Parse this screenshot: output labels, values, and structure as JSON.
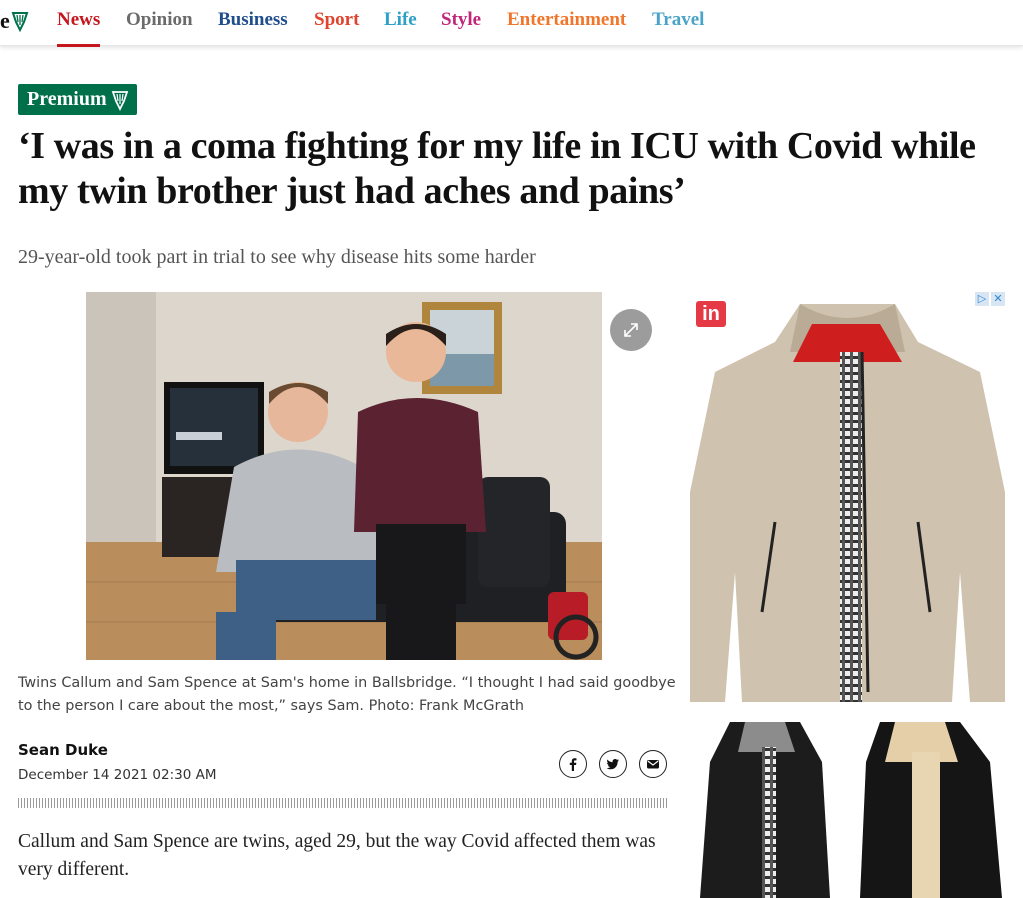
{
  "nav": {
    "logo_fragment": "e",
    "items": [
      {
        "label": "News",
        "color": "#c4161c",
        "active": true
      },
      {
        "label": "Opinion",
        "color": "#6b6b6b"
      },
      {
        "label": "Business",
        "color": "#1f4e8c"
      },
      {
        "label": "Sport",
        "color": "#e0442e"
      },
      {
        "label": "Life",
        "color": "#2ea0c8"
      },
      {
        "label": "Style",
        "color": "#c0267a"
      },
      {
        "label": "Entertainment",
        "color": "#f0762b"
      },
      {
        "label": "Travel",
        "color": "#4aa3c8"
      }
    ]
  },
  "article": {
    "badge": "Premium",
    "headline": "‘I was in a coma fighting for my life in ICU with Covid while my twin brother just had aches and pains’",
    "subheadline": "29-year-old took part in trial to see why disease hits some harder",
    "caption": "Twins Callum and Sam Spence at Sam's home in Ballsbridge. “I thought I had said goodbye to the person I care about the most,” says Sam. Photo: Frank McGrath",
    "author": "Sean Duke",
    "date": "December 14 2021 02:30 AM",
    "body_first": "Callum and Sam Spence are twins, aged 29, but the way Covid affected them was very different.",
    "photo_icon": "expand-icon",
    "share": [
      "facebook-icon",
      "twitter-icon",
      "email-icon"
    ]
  },
  "ad": {
    "brand": "in",
    "choices": [
      "▷",
      "✕"
    ]
  },
  "colors": {
    "accent": "#c4161c",
    "premium": "#00704a"
  }
}
